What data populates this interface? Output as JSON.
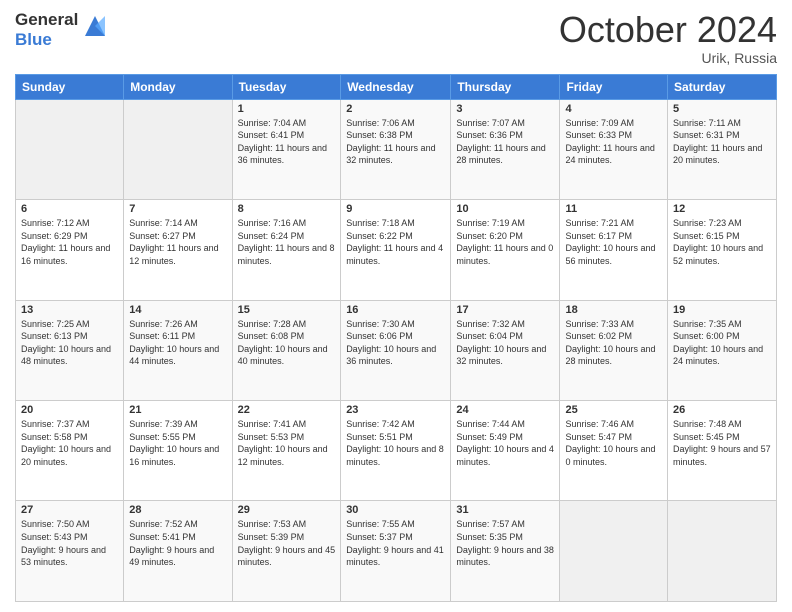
{
  "logo": {
    "general": "General",
    "blue": "Blue"
  },
  "header": {
    "month": "October 2024",
    "location": "Urik, Russia"
  },
  "days_of_week": [
    "Sunday",
    "Monday",
    "Tuesday",
    "Wednesday",
    "Thursday",
    "Friday",
    "Saturday"
  ],
  "weeks": [
    [
      {
        "day": "",
        "info": ""
      },
      {
        "day": "",
        "info": ""
      },
      {
        "day": "1",
        "info": "Sunrise: 7:04 AM\nSunset: 6:41 PM\nDaylight: 11 hours and 36 minutes."
      },
      {
        "day": "2",
        "info": "Sunrise: 7:06 AM\nSunset: 6:38 PM\nDaylight: 11 hours and 32 minutes."
      },
      {
        "day": "3",
        "info": "Sunrise: 7:07 AM\nSunset: 6:36 PM\nDaylight: 11 hours and 28 minutes."
      },
      {
        "day": "4",
        "info": "Sunrise: 7:09 AM\nSunset: 6:33 PM\nDaylight: 11 hours and 24 minutes."
      },
      {
        "day": "5",
        "info": "Sunrise: 7:11 AM\nSunset: 6:31 PM\nDaylight: 11 hours and 20 minutes."
      }
    ],
    [
      {
        "day": "6",
        "info": "Sunrise: 7:12 AM\nSunset: 6:29 PM\nDaylight: 11 hours and 16 minutes."
      },
      {
        "day": "7",
        "info": "Sunrise: 7:14 AM\nSunset: 6:27 PM\nDaylight: 11 hours and 12 minutes."
      },
      {
        "day": "8",
        "info": "Sunrise: 7:16 AM\nSunset: 6:24 PM\nDaylight: 11 hours and 8 minutes."
      },
      {
        "day": "9",
        "info": "Sunrise: 7:18 AM\nSunset: 6:22 PM\nDaylight: 11 hours and 4 minutes."
      },
      {
        "day": "10",
        "info": "Sunrise: 7:19 AM\nSunset: 6:20 PM\nDaylight: 11 hours and 0 minutes."
      },
      {
        "day": "11",
        "info": "Sunrise: 7:21 AM\nSunset: 6:17 PM\nDaylight: 10 hours and 56 minutes."
      },
      {
        "day": "12",
        "info": "Sunrise: 7:23 AM\nSunset: 6:15 PM\nDaylight: 10 hours and 52 minutes."
      }
    ],
    [
      {
        "day": "13",
        "info": "Sunrise: 7:25 AM\nSunset: 6:13 PM\nDaylight: 10 hours and 48 minutes."
      },
      {
        "day": "14",
        "info": "Sunrise: 7:26 AM\nSunset: 6:11 PM\nDaylight: 10 hours and 44 minutes."
      },
      {
        "day": "15",
        "info": "Sunrise: 7:28 AM\nSunset: 6:08 PM\nDaylight: 10 hours and 40 minutes."
      },
      {
        "day": "16",
        "info": "Sunrise: 7:30 AM\nSunset: 6:06 PM\nDaylight: 10 hours and 36 minutes."
      },
      {
        "day": "17",
        "info": "Sunrise: 7:32 AM\nSunset: 6:04 PM\nDaylight: 10 hours and 32 minutes."
      },
      {
        "day": "18",
        "info": "Sunrise: 7:33 AM\nSunset: 6:02 PM\nDaylight: 10 hours and 28 minutes."
      },
      {
        "day": "19",
        "info": "Sunrise: 7:35 AM\nSunset: 6:00 PM\nDaylight: 10 hours and 24 minutes."
      }
    ],
    [
      {
        "day": "20",
        "info": "Sunrise: 7:37 AM\nSunset: 5:58 PM\nDaylight: 10 hours and 20 minutes."
      },
      {
        "day": "21",
        "info": "Sunrise: 7:39 AM\nSunset: 5:55 PM\nDaylight: 10 hours and 16 minutes."
      },
      {
        "day": "22",
        "info": "Sunrise: 7:41 AM\nSunset: 5:53 PM\nDaylight: 10 hours and 12 minutes."
      },
      {
        "day": "23",
        "info": "Sunrise: 7:42 AM\nSunset: 5:51 PM\nDaylight: 10 hours and 8 minutes."
      },
      {
        "day": "24",
        "info": "Sunrise: 7:44 AM\nSunset: 5:49 PM\nDaylight: 10 hours and 4 minutes."
      },
      {
        "day": "25",
        "info": "Sunrise: 7:46 AM\nSunset: 5:47 PM\nDaylight: 10 hours and 0 minutes."
      },
      {
        "day": "26",
        "info": "Sunrise: 7:48 AM\nSunset: 5:45 PM\nDaylight: 9 hours and 57 minutes."
      }
    ],
    [
      {
        "day": "27",
        "info": "Sunrise: 7:50 AM\nSunset: 5:43 PM\nDaylight: 9 hours and 53 minutes."
      },
      {
        "day": "28",
        "info": "Sunrise: 7:52 AM\nSunset: 5:41 PM\nDaylight: 9 hours and 49 minutes."
      },
      {
        "day": "29",
        "info": "Sunrise: 7:53 AM\nSunset: 5:39 PM\nDaylight: 9 hours and 45 minutes."
      },
      {
        "day": "30",
        "info": "Sunrise: 7:55 AM\nSunset: 5:37 PM\nDaylight: 9 hours and 41 minutes."
      },
      {
        "day": "31",
        "info": "Sunrise: 7:57 AM\nSunset: 5:35 PM\nDaylight: 9 hours and 38 minutes."
      },
      {
        "day": "",
        "info": ""
      },
      {
        "day": "",
        "info": ""
      }
    ]
  ]
}
